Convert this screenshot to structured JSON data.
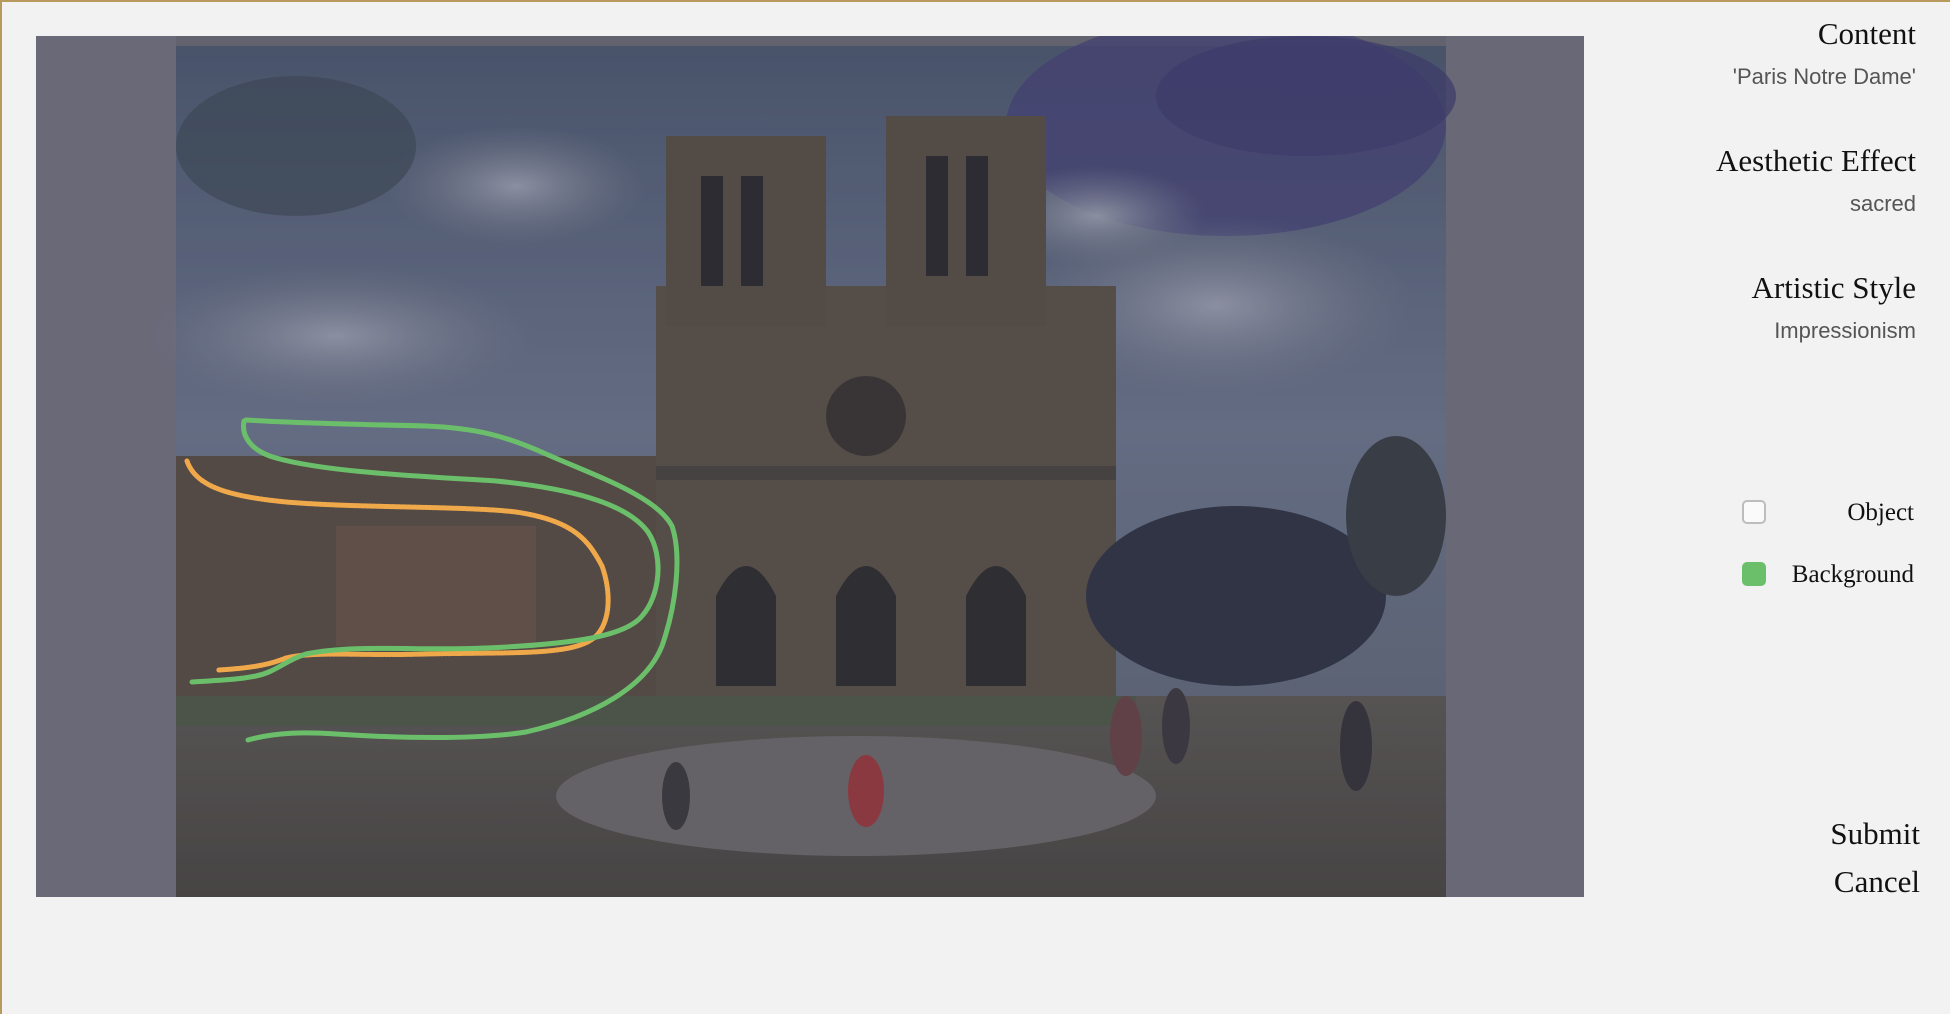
{
  "image": {
    "icon": "notre-dame-painting",
    "stroke_colors": {
      "object": "#f0a94a",
      "background": "#6cbf6a"
    }
  },
  "fields": {
    "content": {
      "title": "Content",
      "value": "'Paris Notre Dame'"
    },
    "aesthetic_effect": {
      "title": "Aesthetic Effect",
      "value": "sacred"
    },
    "artistic_style": {
      "title": "Artistic Style",
      "value": "Impressionism"
    }
  },
  "layers": [
    {
      "label": "Object",
      "selected": false,
      "color": "#fafafa"
    },
    {
      "label": "Background",
      "selected": true,
      "color": "#6cbf6a"
    }
  ],
  "actions": {
    "submit": "Submit",
    "cancel": "Cancel"
  }
}
